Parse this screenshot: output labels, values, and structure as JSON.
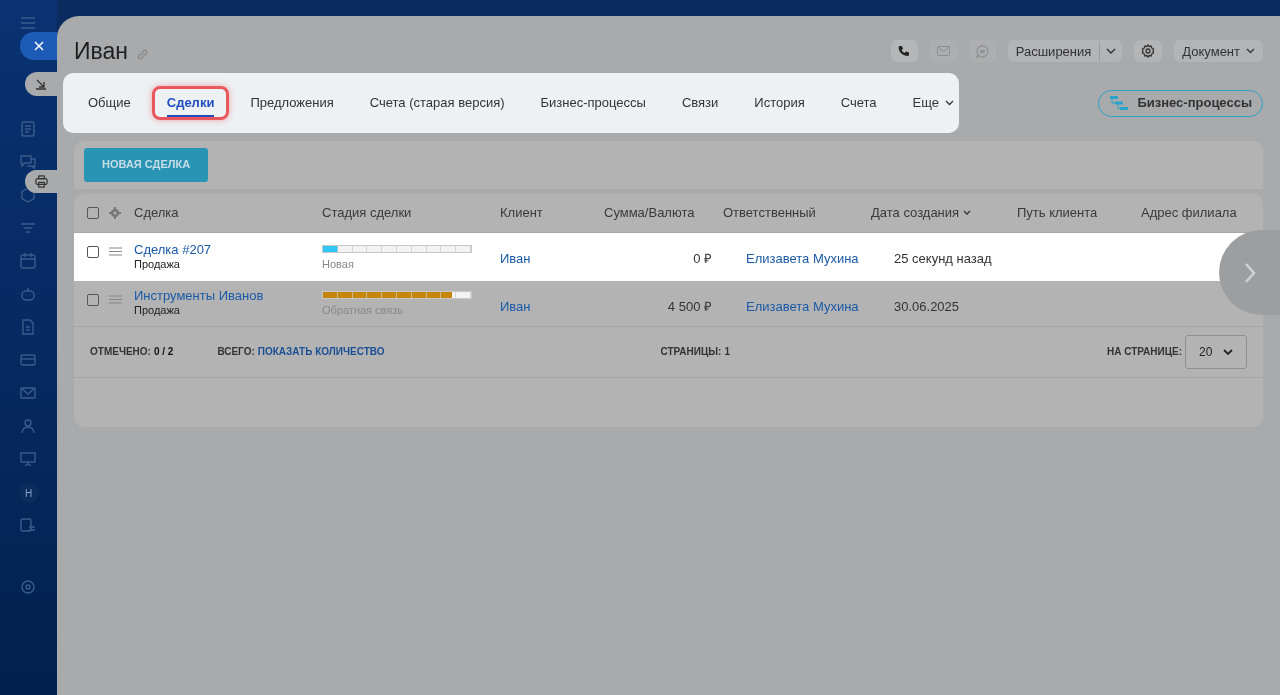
{
  "sidebar": {
    "avatar_letter": "H"
  },
  "title": "Иван",
  "header_actions": {
    "extensions": "Расширения",
    "document": "Документ"
  },
  "tabs": [
    {
      "label": "Общие",
      "selected": false
    },
    {
      "label": "Сделки",
      "selected": true
    },
    {
      "label": "Предложения",
      "selected": false
    },
    {
      "label": "Счета (старая версия)",
      "selected": false
    },
    {
      "label": "Бизнес-процессы",
      "selected": false
    },
    {
      "label": "Связи",
      "selected": false
    },
    {
      "label": "История",
      "selected": false
    },
    {
      "label": "Счета",
      "selected": false
    },
    {
      "label": "Еще",
      "selected": false
    }
  ],
  "bp_button": "Бизнес-процессы",
  "new_button": "НОВАЯ СДЕЛКА",
  "table": {
    "select_all_checked": false,
    "columns": [
      {
        "label": "Сделка",
        "sorted": false
      },
      {
        "label": "Стадия сделки",
        "sorted": false
      },
      {
        "label": "Клиент",
        "sorted": false
      },
      {
        "label": "Сумма/Валюта",
        "sorted": false
      },
      {
        "label": "Ответственный",
        "sorted": false
      },
      {
        "label": "Дата создания",
        "sorted": true
      },
      {
        "label": "Путь клиента",
        "sorted": false
      },
      {
        "label": "Адрес филиала",
        "sorted": false
      }
    ],
    "rows": [
      {
        "title": "Сделка #207",
        "subtitle": "Продажа",
        "level": 0.1,
        "color": "#2fc6f6",
        "stage": "Новая",
        "client": "Иван",
        "amount": "0 ₽",
        "owner": "Елизавета Мухина",
        "created": "25 секунд назад",
        "highlighted": true,
        "checked": false
      },
      {
        "title": "Инструменты Иванов",
        "subtitle": "Продажа",
        "level": 0.87,
        "color": "#c5850a",
        "stage": "Обратная связь",
        "client": "Иван",
        "amount": "4 500 ₽",
        "owner": "Елизавета Мухина",
        "created": "30.06.2025",
        "highlighted": false,
        "checked": false
      }
    ]
  },
  "footer": {
    "checked_label": "ОТМЕЧЕНО:",
    "checked_value": "0 / 2",
    "total_label": "ВСЕГО:",
    "total_link": "ПОКАЗАТЬ КОЛИЧЕСТВО",
    "pages_label": "СТРАНИЦЫ:",
    "pages_value": "1",
    "per_page_label": "НА СТРАНИЦЕ:",
    "per_page_value": "20"
  }
}
